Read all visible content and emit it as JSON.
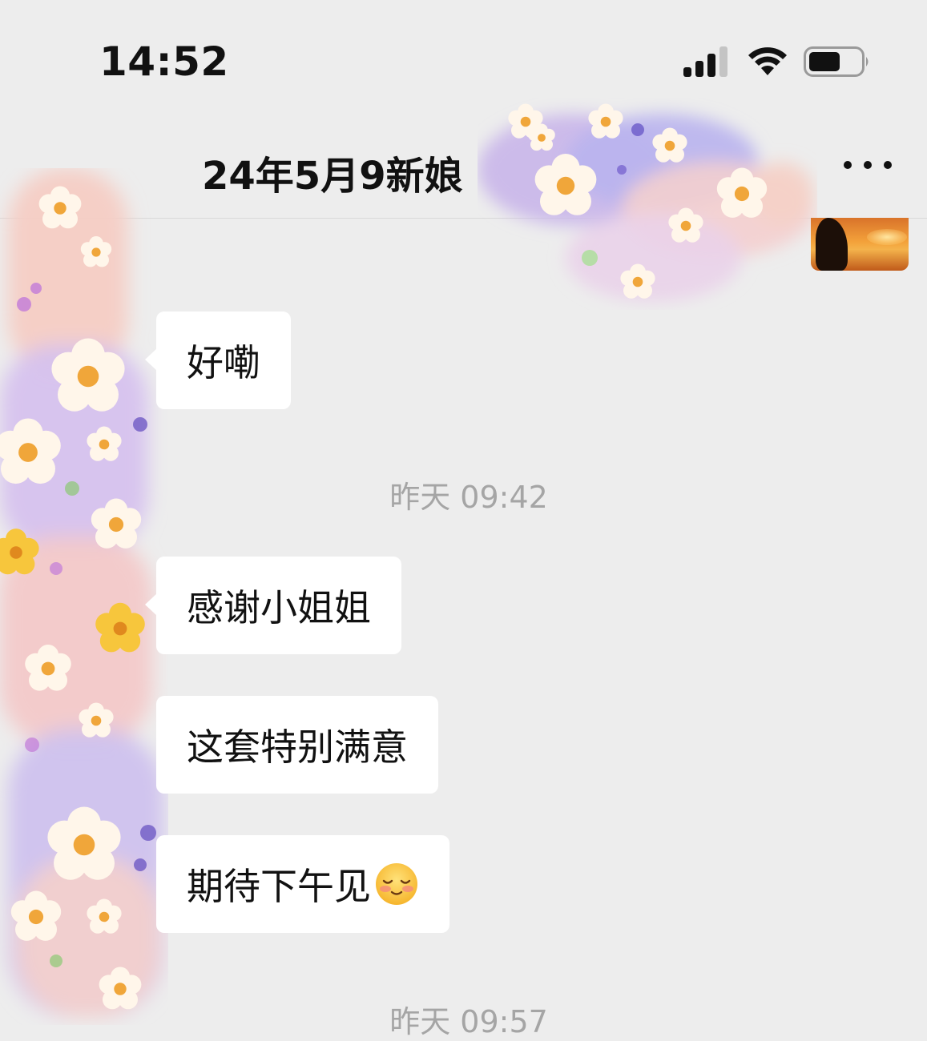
{
  "status_bar": {
    "time": "14:52"
  },
  "header": {
    "title": "24年5月9新娘"
  },
  "messages": [
    {
      "text": "好嘞"
    },
    {
      "text": "感谢小姐姐"
    },
    {
      "text": "这套特别满意"
    },
    {
      "text": "期待下午见",
      "emoji": "relieved-face-icon"
    }
  ],
  "timestamps": [
    {
      "text": "昨天 09:42"
    },
    {
      "text": "昨天 09:57"
    }
  ],
  "colors": {
    "background": "#ededed",
    "bubble": "#ffffff",
    "timestamp": "#a5a5a5"
  }
}
